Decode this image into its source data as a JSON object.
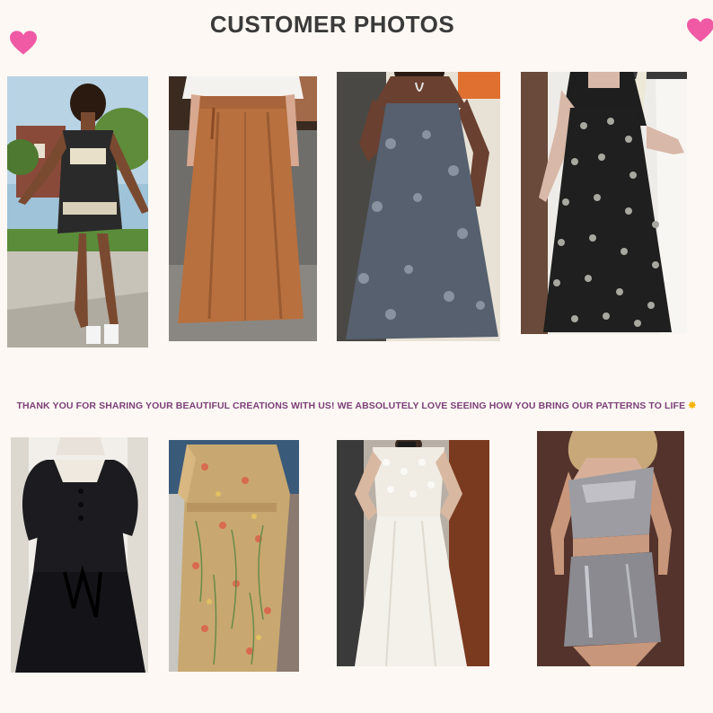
{
  "header": {
    "title": "CUSTOMER PHOTOS"
  },
  "decor": {
    "heart_color": "#f05aa5",
    "left_heart_icon": "heart-icon",
    "right_heart_icon": "heart-icon"
  },
  "gallery": {
    "row1": [
      "photo-1",
      "photo-2",
      "photo-3",
      "photo-4"
    ],
    "row2": [
      "photo-5",
      "photo-6",
      "photo-7",
      "photo-8"
    ]
  },
  "message": {
    "text": "THANK YOU FOR SHARING YOUR BEAUTIFUL CREATIONS WITH US! WE ABSOLUTELY LOVE SEEING HOW YOU BRING OUR PATTERNS TO LIFE",
    "sparkle_icon": "sparkle-icon",
    "color": "#7b3f78"
  }
}
